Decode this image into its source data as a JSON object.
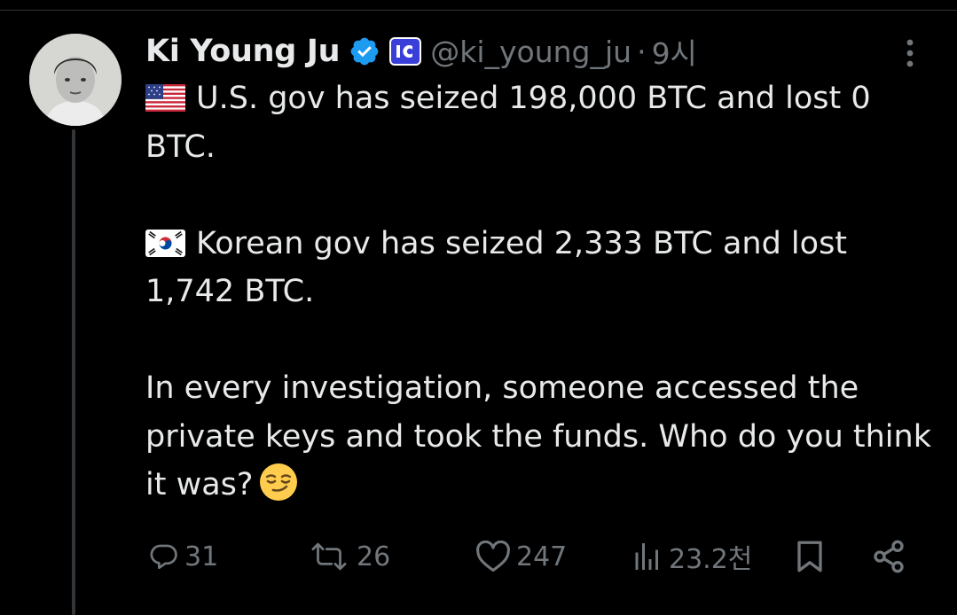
{
  "tweet": {
    "author": {
      "display_name": "Ki Young Ju",
      "handle": "@ki_young_ju",
      "separator": "·",
      "timestamp": "9시"
    },
    "text": {
      "line_us": "U.S. gov has seized 198,000 BTC and lost 0 BTC.",
      "line_kr": "Korean gov has seized 2,333 BTC and lost 1,742 BTC.",
      "line_question": "In every investigation, someone accessed the private keys and took the funds. Who do you think it was?"
    },
    "emoji": "smirking-face",
    "flags": [
      "us-flag",
      "south-korea-flag"
    ],
    "stats": {
      "replies": "31",
      "reposts": "26",
      "likes": "247",
      "views": "23.2천"
    }
  },
  "icons": {
    "verified": "verified-check-icon",
    "affiliate": "affiliate-badge-icon",
    "more": "more-vertical-icon",
    "reply": "reply-icon",
    "repost": "repost-icon",
    "like": "heart-icon",
    "views": "views-icon",
    "bookmark": "bookmark-icon",
    "share": "share-icon"
  },
  "colors": {
    "background": "#000000",
    "text_primary": "#e7e9ea",
    "text_secondary": "#71767b",
    "verified_blue": "#1d9bf0",
    "thread_line": "#333639"
  }
}
